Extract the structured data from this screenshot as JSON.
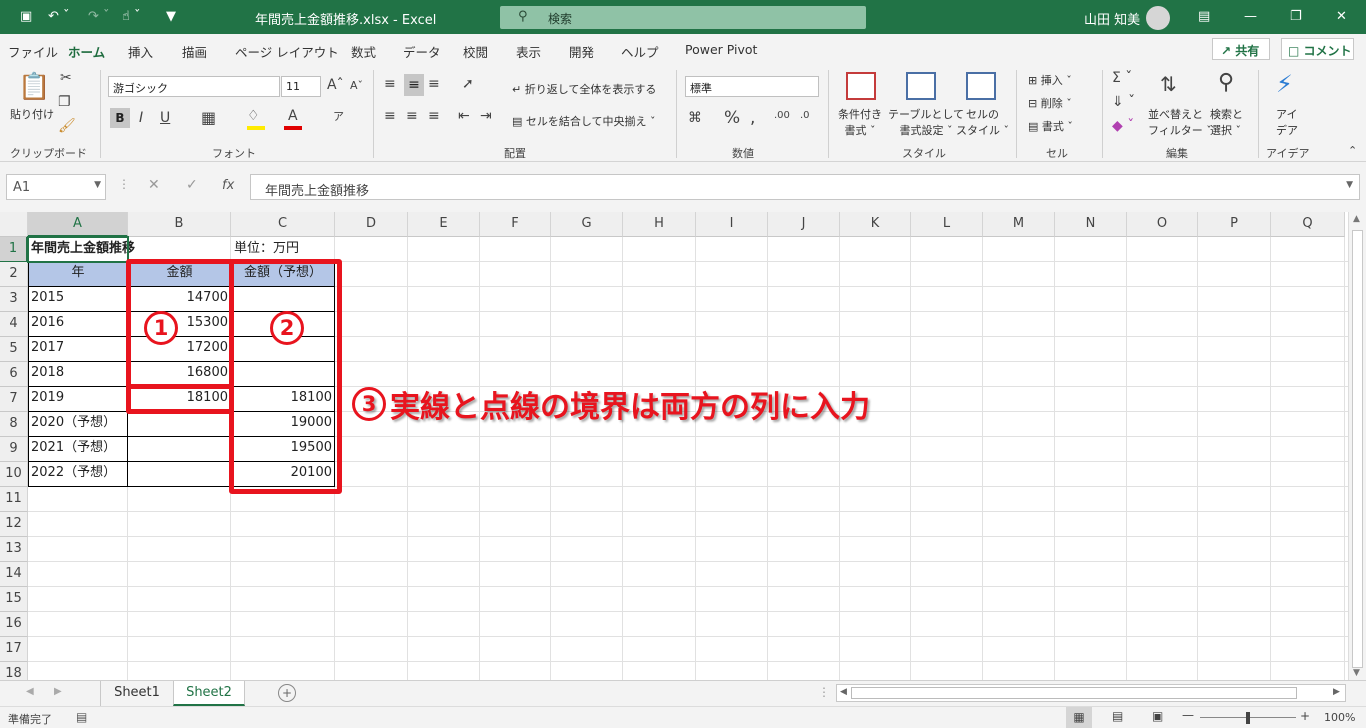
{
  "titlebar": {
    "filename": "年間売上金額推移.xlsx",
    "sep": "-",
    "app": "Excel",
    "search_placeholder": "検索",
    "user": "山田 知美"
  },
  "menu": [
    "ファイル",
    "ホーム",
    "挿入",
    "描画",
    "ページ レイアウト",
    "数式",
    "データ",
    "校閲",
    "表示",
    "開発",
    "ヘルプ",
    "Power Pivot"
  ],
  "share_label": "共有",
  "comment_label": "コメント",
  "ribbon": {
    "clipboard": {
      "paste": "貼り付け",
      "group": "クリップボード"
    },
    "font": {
      "name": "游ゴシック",
      "size": "11",
      "group": "フォント"
    },
    "alignment": {
      "wrap": "折り返して全体を表示する",
      "merge": "セルを結合して中央揃え",
      "group": "配置"
    },
    "number": {
      "format": "標準",
      "group": "数値"
    },
    "styles": {
      "conditional": "条件付き書式",
      "table": "テーブルとして書式設定",
      "cell": "セルのスタイル",
      "cond_1": "条件付き",
      "cond_2": "書式",
      "table_1": "テーブルとして",
      "table_2": "書式設定",
      "cell_1": "セルの",
      "cell_2": "スタイル",
      "group": "スタイル"
    },
    "cells": {
      "insert": "挿入",
      "delete": "削除",
      "format": "書式",
      "group": "セル"
    },
    "editing": {
      "sort_1": "並べ替えと",
      "sort_2": "フィルター",
      "find_1": "検索と",
      "find_2": "選択",
      "group": "編集"
    },
    "ideas": {
      "l1": "アイ",
      "l2": "デア",
      "group": "アイデア"
    }
  },
  "formula_bar": {
    "name_box": "A1",
    "fx": "fx",
    "content": "年間売上金額推移"
  },
  "columns": [
    "A",
    "B",
    "C",
    "D",
    "E",
    "F",
    "G",
    "H",
    "I",
    "J",
    "K",
    "L",
    "M",
    "N",
    "O",
    "P",
    "Q"
  ],
  "rows": [
    "1",
    "2",
    "3",
    "4",
    "5",
    "6",
    "7",
    "8",
    "9",
    "10",
    "11",
    "12",
    "13",
    "14",
    "15",
    "16",
    "17",
    "18"
  ],
  "cells": {
    "A1": "年間売上金額推移",
    "C1": "単位：万円",
    "A2": "年",
    "B2": "金額",
    "C2": "金額（予想）",
    "A3": "2015",
    "B3": "14700",
    "A4": "2016",
    "B4": "15300",
    "A5": "2017",
    "B5": "17200",
    "A6": "2018",
    "B6": "16800",
    "A7": "2019",
    "B7": "18100",
    "C7": "18100",
    "A8": "2020（予想）",
    "C8": "19000",
    "A9": "2021（予想）",
    "C9": "19500",
    "A10": "2022（予想）",
    "C10": "20100"
  },
  "annotations": {
    "c1": "1",
    "c2": "2",
    "c3": "3",
    "note": "実線と点線の境界は両方の列に入力"
  },
  "sheets": [
    "Sheet1",
    "Sheet2"
  ],
  "active_sheet": "Sheet2",
  "status": {
    "ready": "準備完了",
    "zoom": "100%"
  },
  "colors": {
    "excel_green": "#217346",
    "annotation_red": "#e8141e",
    "header_fill": "#b4c6e7"
  }
}
